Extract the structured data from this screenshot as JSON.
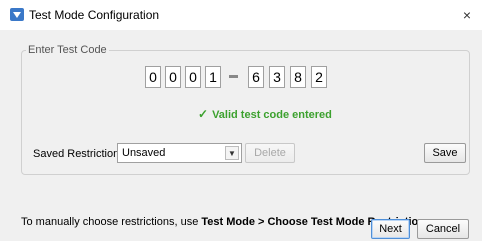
{
  "window": {
    "title": "Test Mode Configuration",
    "close_glyph": "×",
    "app_icon": "test-mode-app-icon",
    "close_icon": "close-icon"
  },
  "enter_code": {
    "legend": "Enter Test Code",
    "digits": [
      "0",
      "0",
      "0",
      "1",
      "6",
      "3",
      "8",
      "2"
    ],
    "status_icon": "checkmark-icon",
    "status_glyph": "✓",
    "status_text": "Valid test code entered",
    "status_color": "#3ca12e"
  },
  "restrictions": {
    "label": "Saved Restrictions",
    "selected": "Unsaved",
    "dropdown_icon": "chevron-down-icon",
    "delete_label": "Delete",
    "save_label": "Save"
  },
  "info": {
    "prefix": "To manually choose restrictions, use ",
    "emphasis": "Test Mode > Choose Test Mode Restrictions."
  },
  "footer": {
    "next_label": "Next",
    "cancel_label": "Cancel"
  }
}
